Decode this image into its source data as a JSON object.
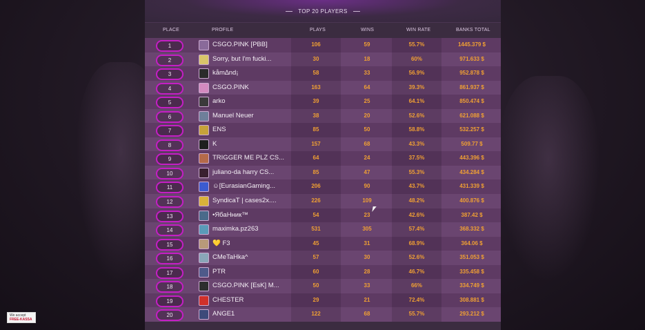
{
  "header": {
    "title": "TOP 20 PLAYERS"
  },
  "columns": {
    "place": "PLACE",
    "profile": "PROFILE",
    "plays": "PLAYS",
    "wins": "WINS",
    "win_rate": "WIN RATE",
    "banks_total": "BANKS TOTAL"
  },
  "rows": [
    {
      "place": "1",
      "name": "CSGO.PINK [PBB]",
      "plays": "106",
      "wins": "59",
      "rate": "55.7%",
      "bank": "1445.379 $",
      "avatar_color": "#8a6a9a"
    },
    {
      "place": "2",
      "name": "Sorry, but I'm fucki...",
      "plays": "30",
      "wins": "18",
      "rate": "60%",
      "bank": "971.633 $",
      "avatar_color": "#d8c46a"
    },
    {
      "place": "3",
      "name": "kåm∆nd¡",
      "plays": "58",
      "wins": "33",
      "rate": "56.9%",
      "bank": "952.878 $",
      "avatar_color": "#2b2b2b"
    },
    {
      "place": "4",
      "name": "CSGO.PINK",
      "plays": "163",
      "wins": "64",
      "rate": "39.3%",
      "bank": "861.937 $",
      "avatar_color": "#d48ac0"
    },
    {
      "place": "5",
      "name": "arko",
      "plays": "39",
      "wins": "25",
      "rate": "64.1%",
      "bank": "850.474 $",
      "avatar_color": "#3a3a3a"
    },
    {
      "place": "6",
      "name": "Manuel Neuer",
      "plays": "38",
      "wins": "20",
      "rate": "52.6%",
      "bank": "621.088 $",
      "avatar_color": "#6f7f9a"
    },
    {
      "place": "7",
      "name": "ENS",
      "plays": "85",
      "wins": "50",
      "rate": "58.8%",
      "bank": "532.257 $",
      "avatar_color": "#c6a23a"
    },
    {
      "place": "8",
      "name": "K",
      "plays": "157",
      "wins": "68",
      "rate": "43.3%",
      "bank": "509.77 $",
      "avatar_color": "#1f1f1f"
    },
    {
      "place": "9",
      "name": "TRIGGER ME PLZ CS...",
      "plays": "64",
      "wins": "24",
      "rate": "37.5%",
      "bank": "443.396 $",
      "avatar_color": "#b56a4a"
    },
    {
      "place": "10",
      "name": "juliano-da harry CS...",
      "plays": "85",
      "wins": "47",
      "rate": "55.3%",
      "bank": "434.284 $",
      "avatar_color": "#3a2030"
    },
    {
      "place": "11",
      "name": "☺[EurasianGaming...",
      "plays": "206",
      "wins": "90",
      "rate": "43.7%",
      "bank": "431.339 $",
      "avatar_color": "#3c5bd0"
    },
    {
      "place": "12",
      "name": "SyndicaT | cases2x....",
      "plays": "226",
      "wins": "109",
      "rate": "48.2%",
      "bank": "400.876 $",
      "avatar_color": "#d8b23a"
    },
    {
      "place": "13",
      "name": "•ЯбаНник™",
      "plays": "54",
      "wins": "23",
      "rate": "42.6%",
      "bank": "387.42 $",
      "avatar_color": "#4a6a8a"
    },
    {
      "place": "14",
      "name": "maximka.pz263",
      "plays": "531",
      "wins": "305",
      "rate": "57.4%",
      "bank": "368.332 $",
      "avatar_color": "#5a9ab8"
    },
    {
      "place": "15",
      "name": "💛 F3",
      "plays": "45",
      "wins": "31",
      "rate": "68.9%",
      "bank": "364.06 $",
      "avatar_color": "#b89a7a"
    },
    {
      "place": "16",
      "name": "CMeTaHka^",
      "plays": "57",
      "wins": "30",
      "rate": "52.6%",
      "bank": "351.053 $",
      "avatar_color": "#8aa6b8"
    },
    {
      "place": "17",
      "name": "PTR",
      "plays": "60",
      "wins": "28",
      "rate": "46.7%",
      "bank": "335.458 $",
      "avatar_color": "#4f5a8a"
    },
    {
      "place": "18",
      "name": "CSGO.PINK [EsK] M...",
      "plays": "50",
      "wins": "33",
      "rate": "66%",
      "bank": "334.749 $",
      "avatar_color": "#2e2e2e"
    },
    {
      "place": "19",
      "name": "CHESTER",
      "plays": "29",
      "wins": "21",
      "rate": "72.4%",
      "bank": "308.881 $",
      "avatar_color": "#d0302a"
    },
    {
      "place": "20",
      "name": "ANGE1",
      "plays": "122",
      "wins": "68",
      "rate": "55.7%",
      "bank": "293.212 $",
      "avatar_color": "#3d4a7a"
    }
  ],
  "badge": {
    "line1": "We accept",
    "line2": "FREE-KASSA"
  },
  "colors": {
    "accent_pill": "#c51ec5",
    "value_orange": "#f0a033"
  }
}
